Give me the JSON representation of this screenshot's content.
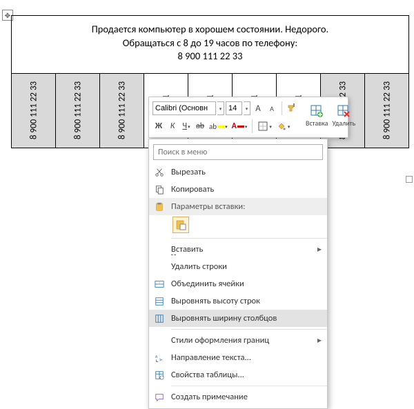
{
  "ad": {
    "line1": "Продается компьютер в хорошем состоянии. Недорого.",
    "line2": "Обращаться с 8 до 19 часов по телефону:",
    "phone": "8 900 111 22 33"
  },
  "strip_phone": "8 900 111 22 33",
  "strip_phone_cut": "8 900 11",
  "mini_toolbar": {
    "font": "Calibri (Основн",
    "size": "14",
    "increase_font": "A",
    "decrease_font": "A",
    "bold": "Ж",
    "italic": "К",
    "underline": "Ч",
    "insert_label": "Вставка",
    "delete_label": "Удалить"
  },
  "context_menu": {
    "search_placeholder": "Поиск в меню",
    "cut": "Вырезать",
    "copy": "Копировать",
    "paste_params": "Параметры вставки:",
    "insert": "Вставить",
    "delete_rows": "Удалить строки",
    "merge_cells": "Объединить ячейки",
    "distribute_rows": "Выровнять высоту строк",
    "distribute_cols": "Выровнять ширину столбцов",
    "border_styles": "Стили оформления границ",
    "text_direction": "Направление текста...",
    "table_props": "Свойства таблицы...",
    "new_comment": "Создать примечание"
  }
}
